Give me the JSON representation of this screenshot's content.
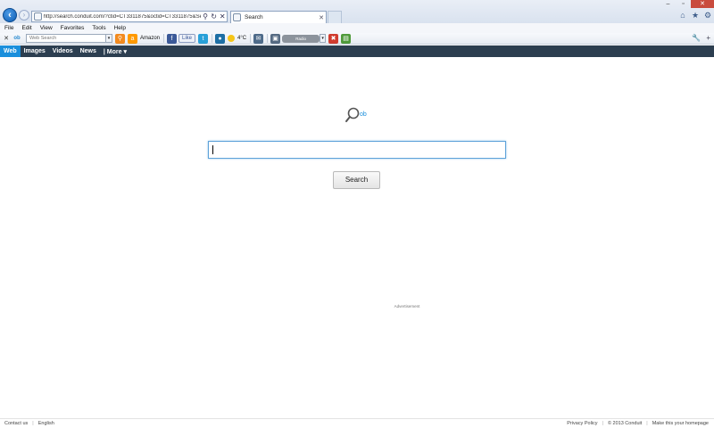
{
  "browser": {
    "back_icon": "back-arrow-icon",
    "forward_icon": "forward-arrow-icon",
    "url": "http://search.conduit.com/?ctid=CT3311875&octid=CT3311875&SearchS",
    "search_glyph": "⚲",
    "refresh_glyph": "↻",
    "close_glyph": "✕",
    "tab_title": "Search",
    "window_controls": [
      "–",
      "▫",
      "✕"
    ],
    "right_icons": [
      "⌂",
      "★",
      "⚙"
    ]
  },
  "menu": [
    "File",
    "Edit",
    "View",
    "Favorites",
    "Tools",
    "Help"
  ],
  "toolbar": {
    "close_glyph": "✕",
    "logo_text": "ob",
    "search_placeholder": "Web Search",
    "search_glyph": "⚲",
    "amazon_label": "Amazon",
    "like_label": "Like",
    "weather_temp": "4°C",
    "radio_label": "Radio",
    "wrench_glyph": "🔧",
    "plus_glyph": "+"
  },
  "search_nav": {
    "items": [
      "Web",
      "Images",
      "Videos",
      "News"
    ],
    "more_label": "| More ▾"
  },
  "main": {
    "logo_text": "ob",
    "query_value": "",
    "search_button": "Search",
    "ad_label": "Advertisement"
  },
  "footer": {
    "left": [
      "Contact us",
      "|",
      "English"
    ],
    "right": [
      "Privacy Policy",
      "|",
      "© 2013 Conduit",
      "|",
      "Make this your homepage"
    ]
  },
  "colors": {
    "nav_bar": "#2c3e50",
    "active_tab": "#1a8fdc",
    "search_border": "#5ea2d9"
  }
}
